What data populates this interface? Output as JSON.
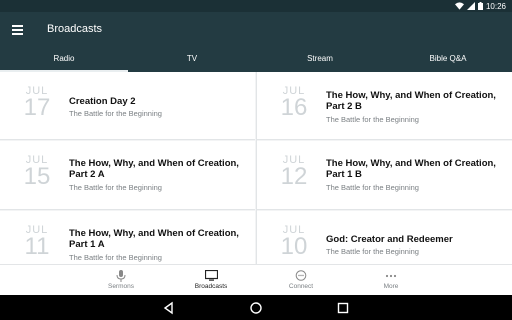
{
  "status_bar": {
    "time": "10:26"
  },
  "app_bar": {
    "title": "Broadcasts"
  },
  "tabs": [
    {
      "label": "Radio",
      "active": true
    },
    {
      "label": "TV",
      "active": false
    },
    {
      "label": "Stream",
      "active": false
    },
    {
      "label": "Bible Q&A",
      "active": false
    }
  ],
  "broadcasts": [
    {
      "month": "JUL",
      "day": "17",
      "title": "Creation Day 2",
      "subtitle": "The Battle for the Beginning"
    },
    {
      "month": "JUL",
      "day": "16",
      "title": "The How, Why, and When of Creation, Part 2 B",
      "subtitle": "The Battle for the Beginning"
    },
    {
      "month": "JUL",
      "day": "15",
      "title": "The How, Why, and When of Creation, Part 2 A",
      "subtitle": "The Battle for the Beginning"
    },
    {
      "month": "JUL",
      "day": "12",
      "title": "The How, Why, and When of Creation, Part 1 B",
      "subtitle": "The Battle for the Beginning"
    },
    {
      "month": "JUL",
      "day": "11",
      "title": "The How, Why, and When of Creation, Part 1 A",
      "subtitle": "The Battle for the Beginning"
    },
    {
      "month": "JUL",
      "day": "10",
      "title": "God: Creator and Redeemer",
      "subtitle": "The Battle for the Beginning"
    }
  ],
  "bottom_nav": [
    {
      "label": "Sermons",
      "icon": "microphone-icon",
      "active": false
    },
    {
      "label": "Broadcasts",
      "icon": "tv-icon",
      "active": true
    },
    {
      "label": "Connect",
      "icon": "chat-bubble-icon",
      "active": false
    },
    {
      "label": "More",
      "icon": "more-dots-icon",
      "active": false
    }
  ],
  "colors": {
    "app_bar": "#233b42",
    "status_bar": "#1b3036",
    "date_text": "#cfd4d7"
  }
}
